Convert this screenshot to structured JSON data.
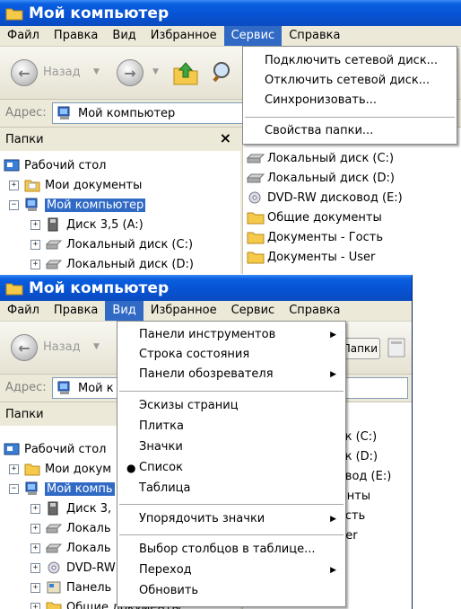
{
  "window_title": "Мой компьютер",
  "menubar": [
    "Файл",
    "Правка",
    "Вид",
    "Избранное",
    "Сервис",
    "Справка"
  ],
  "toolbar": {
    "back_label": "Назад",
    "folders_label": "Папки"
  },
  "address": {
    "label": "Адрес:",
    "value": "Мой компьютер",
    "value_clipped": "Мой к"
  },
  "folders_pane": {
    "title": "Папки",
    "close": "×"
  },
  "tree_top": [
    "Рабочий стол",
    "Мои документы",
    "Мой компьютер",
    "Диск 3,5 (A:)",
    "Локальный диск (C:)",
    "Локальный диск (D:)"
  ],
  "tree_bottom": [
    "Рабочий стол",
    "Мои докум",
    "Мой компь",
    "Диск 3,",
    "Локаль",
    "Локаль",
    "DVD-RW",
    "Панель",
    "Общие документы"
  ],
  "list_top": [
    "Локальный диск (C:)",
    "Локальный диск (D:)",
    "DVD-RW дисковод (E:)",
    "Общие документы",
    "Документы - Гость",
    "Документы - User"
  ],
  "list_bottom": [
    "иск (C:)",
    "иск (D:)",
    "ковод (E:)",
    "менты",
    "Гость",
    "User"
  ],
  "service_menu": [
    "Подключить сетевой диск...",
    "Отключить сетевой диск...",
    "Синхронизовать...",
    "Свойства папки..."
  ],
  "view_menu": {
    "group1": [
      "Панели инструментов",
      "Строка состояния",
      "Панели обозревателя"
    ],
    "group2": [
      "Эскизы страниц",
      "Плитка",
      "Значки",
      "Список",
      "Таблица"
    ],
    "group3": [
      "Упорядочить значки"
    ],
    "group4": [
      "Выбор столбцов в таблице...",
      "Переход",
      "Обновить"
    ],
    "selected": "Список"
  },
  "colors": {
    "title_bar": "#0a5fe0",
    "menu_highlight": "#316ac5",
    "chrome": "#ece9d8"
  }
}
